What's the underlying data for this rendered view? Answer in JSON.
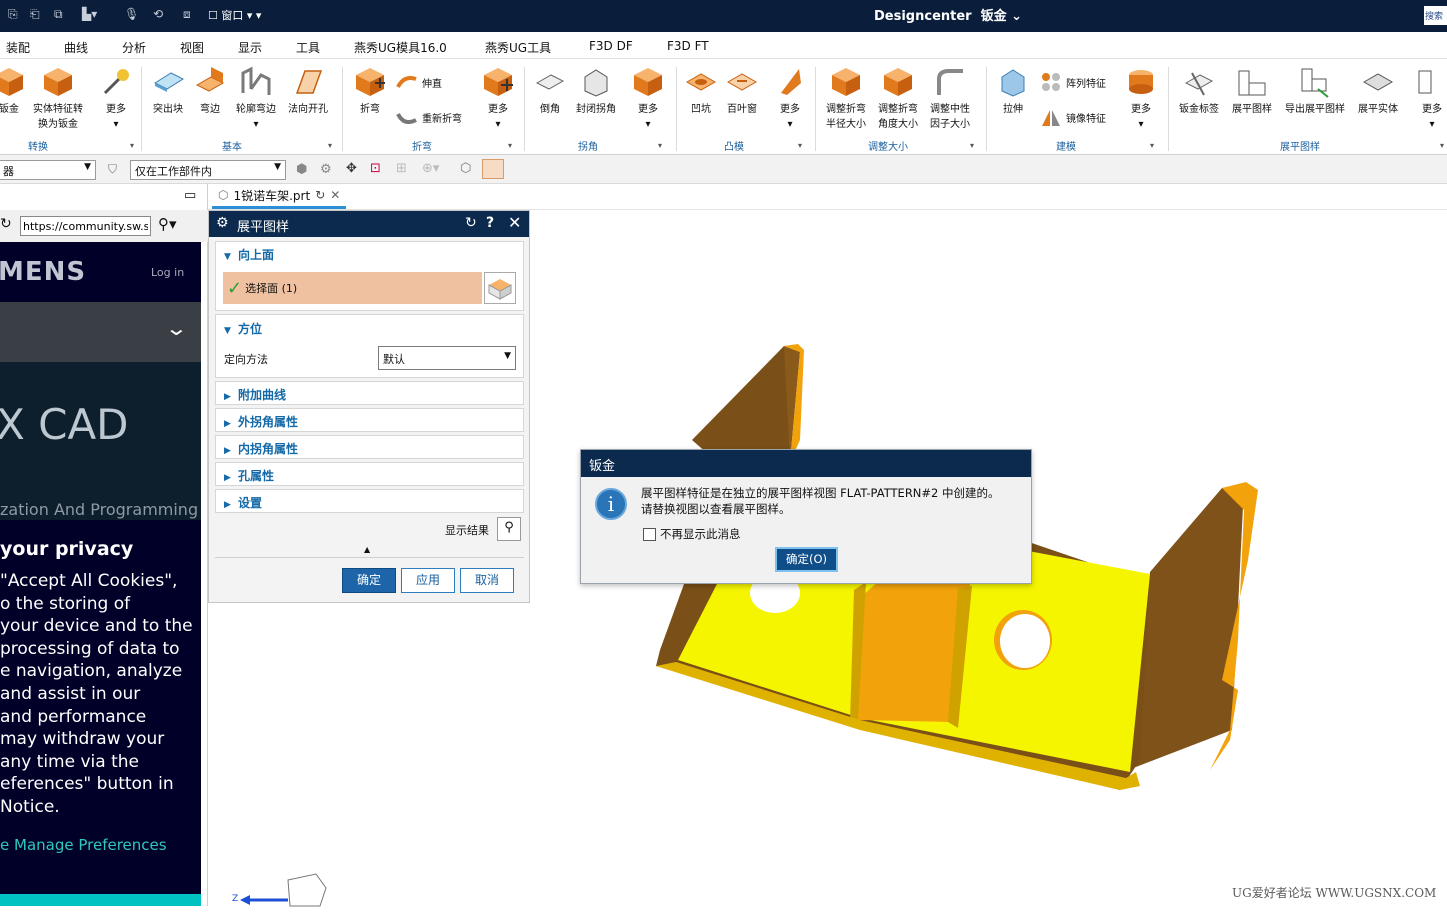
{
  "window": {
    "title": "Designcenter",
    "module": "钣金 ⌄",
    "search": "搜索",
    "window_menu": "窗口"
  },
  "menu": [
    "装配",
    "曲线",
    "分析",
    "视图",
    "显示",
    "工具",
    "燕秀UG模具16.0",
    "燕秀UG工具",
    "F3D DF",
    "F3D FT"
  ],
  "ribbon": {
    "groups": [
      "转换",
      "基本",
      "折弯",
      "拐角",
      "凸模",
      "调整大小",
      "建模",
      "展平图样"
    ],
    "buttons": [
      "钣金",
      "实体特征转\n换为钣金",
      "更多",
      "突出块",
      "弯边",
      "轮廓弯边",
      "法向开孔",
      "折弯",
      "更多",
      "倒角",
      "封闭拐角",
      "更多",
      "凹坑",
      "百叶窗",
      "更多",
      "调整折弯\n半径大小",
      "调整折弯\n角度大小",
      "调整中性\n因子大小",
      "拉伸",
      "更多",
      "钣金标签",
      "展平图样",
      "导出展平图样",
      "展平实体",
      "更多"
    ],
    "small": [
      "伸直",
      "重新折弯",
      "阵列特征",
      "镜像特征"
    ]
  },
  "filter": {
    "type_filter": "器",
    "scope": "仅在工作部件内"
  },
  "doc_tab": {
    "name": "1锐诺车架.prt"
  },
  "browser": {
    "url": "https://community.sw.siemens.com",
    "logo": "MENS",
    "login": "Log in",
    "hero": "X CAD",
    "sub": "zation And Programming",
    "cookie_title": "your privacy",
    "cookie_body": "\"Accept All Cookies\",\no the storing of\nyour device and to the\nprocessing of data to\ne navigation, analyze\nand assist in our\nand performance\nmay withdraw your\nany time via the\neferences\" button in\nNotice.",
    "manage": "e   Manage Preferences"
  },
  "dialog": {
    "title": "展平图样",
    "sections": [
      {
        "label": "向上面",
        "expanded": true
      },
      {
        "label": "方位",
        "expanded": true
      },
      {
        "label": "附加曲线",
        "expanded": false
      },
      {
        "label": "外拐角属性",
        "expanded": false
      },
      {
        "label": "内拐角属性",
        "expanded": false
      },
      {
        "label": "孔属性",
        "expanded": false
      },
      {
        "label": "设置",
        "expanded": false
      }
    ],
    "select_face": "选择面 (1)",
    "orient_label": "定向方法",
    "orient_value": "默认",
    "show_result": "显示结果",
    "ok": "确定",
    "apply": "应用",
    "cancel": "取消"
  },
  "message": {
    "title": "钣金",
    "text": "展平图样特征是在独立的展平图样视图 FLAT-PATTERN#2 中创建的。\n请替换视图以查看展平图样。",
    "checkbox": "不再显示此消息",
    "checked": false,
    "ok": "确定(O)"
  },
  "triad": {
    "z": "Z"
  },
  "watermark": "UG爱好者论坛 WWW.UGSNX.COM",
  "colors": {
    "titlebar": "#0a1e3c",
    "part_yellow": "#ffff00",
    "part_orange": "#e8a000",
    "part_edge": "#8a5a10",
    "select_highlight": "#efc1a0",
    "accent": "#1469a8"
  }
}
